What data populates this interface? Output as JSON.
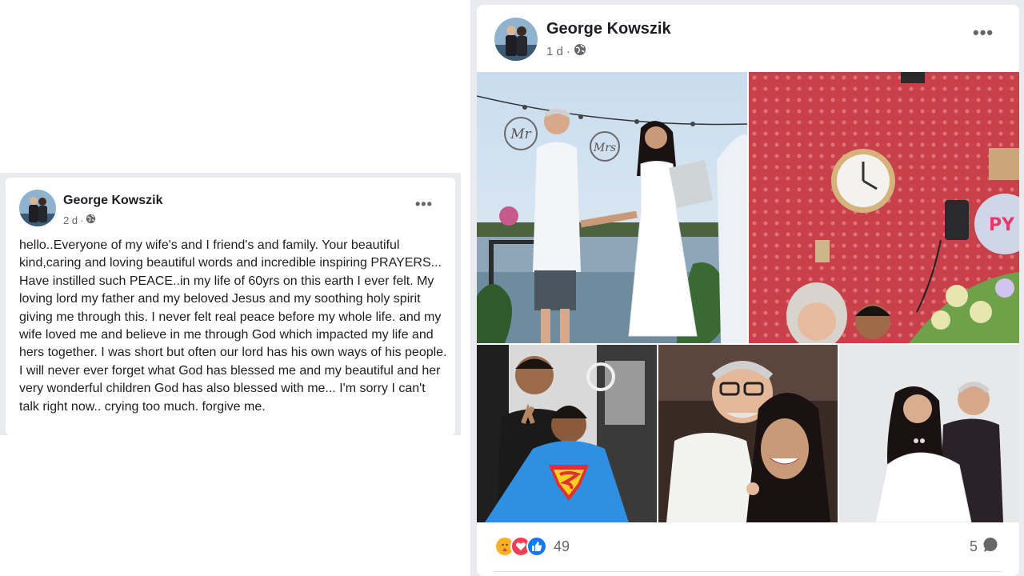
{
  "left_post": {
    "author": "George Kowszik",
    "time": "2 d",
    "more": "•••",
    "text": "hello..Everyone of my wife's and I friend's and family. Your beautiful kind,caring and loving beautiful words and incredible inspiring PRAYERS... Have instilled such PEACE..in my life of 60yrs on this earth I ever felt. My loving lord my father and my beloved Jesus and my soothing holy spirit giving me through this. I never felt real peace before my whole life. and my wife loved me and believe in me through God which impacted my life and hers together. I was short but often our lord has his own ways of his people. I will never ever forget what God has blessed me and my beautiful and her very wonderful children God has also blessed with me... I'm sorry I can't talk right now.. crying too much. forgive me."
  },
  "right_post": {
    "author": "George Kowszik",
    "time": "1 d",
    "more": "•••",
    "photos": [
      "wedding-photo",
      "birthday-photo",
      "barber-photo",
      "selfie-photo",
      "couple-portrait-photo"
    ],
    "wedding_signs": [
      "Mr",
      "Mrs"
    ],
    "balloon_text": "PY",
    "reactions": {
      "icons": [
        "care-icon",
        "love-icon",
        "like-icon"
      ],
      "count": "49"
    },
    "comments_count": "5"
  },
  "colors": {
    "name_text": "#1c1e21",
    "meta_text": "#65676b",
    "frame_bg": "#e9ebee",
    "like_blue": "#1877f2",
    "love_red": "#f33e58",
    "care_yellow": "#f7b125"
  },
  "icons": {
    "globe": "globe-icon",
    "more": "more-options-icon",
    "comment": "comment-bubble-icon"
  }
}
